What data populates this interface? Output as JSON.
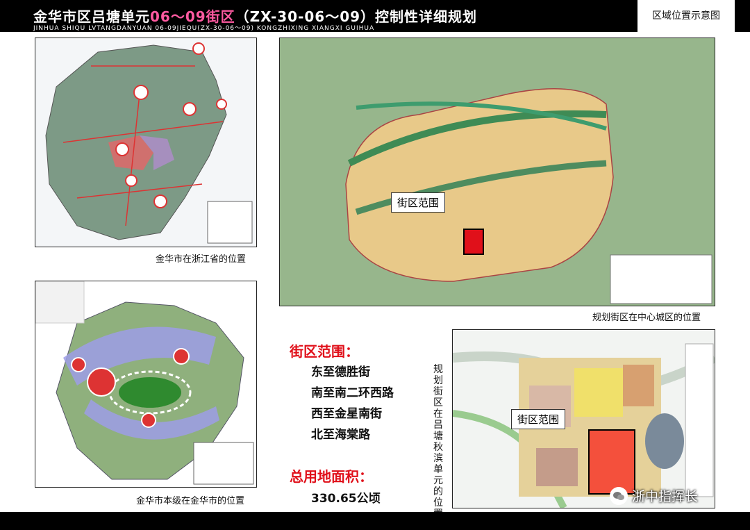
{
  "header": {
    "title_part1": "金华市区吕塘单元",
    "title_highlight": "06～09街区",
    "title_part2": "（ZX-30-06～09）控制性详细规划",
    "subtitle": "JINHUA SHIQU LVTANGDANYUAN 06-09JIEQU(ZX-30-06～09) KONGZHIXING XIANGXI GUIHUA",
    "section_label": "区域位置示意图"
  },
  "captions": {
    "province": "金华市在浙江省的位置",
    "city_level": "金华市本级在金华市的位置",
    "center_city": "规划街区在中心城区的位置",
    "unit": "规划街区在吕塘秋滨单元的位置"
  },
  "callouts": {
    "center_map": "街区范围",
    "unit_map": "街区范围"
  },
  "boundary": {
    "title": "街区范围：",
    "east": "东至德胜街",
    "south": "南至南二环西路",
    "west": "西至金星南街",
    "north": "北至海棠路"
  },
  "area": {
    "title": "总用地面积：",
    "value": "330.65公顷"
  },
  "watermark": "浙中指挥长",
  "colors": {
    "accent_red": "#e0101a",
    "title_highlight": "#ff5aa0",
    "header_bg": "#000000"
  }
}
